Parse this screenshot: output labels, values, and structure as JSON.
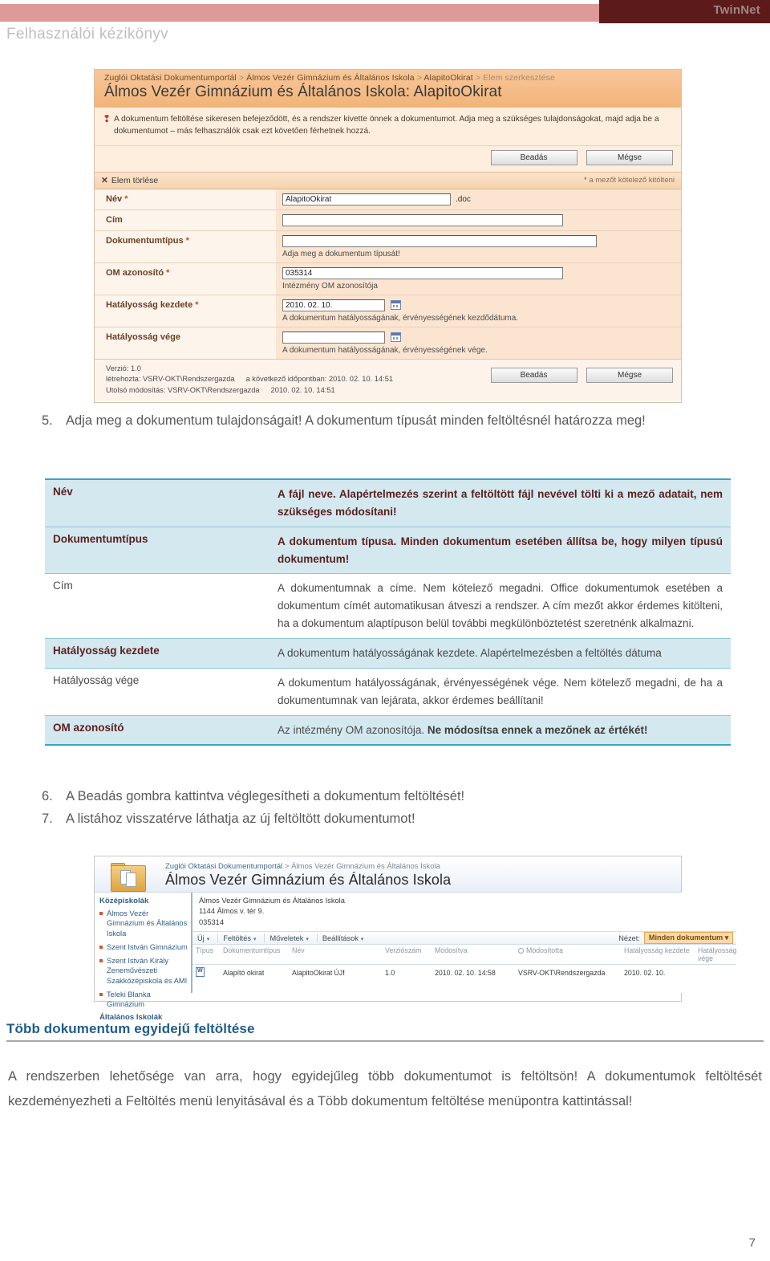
{
  "page_header": {
    "subtitle": "Felhasználói kézikönyv",
    "logo": "TwinNet",
    "band_color": "#de9a98",
    "logo_bg": "#5d1a1a"
  },
  "form_screenshot": {
    "breadcrumb": {
      "part1": "Zuglói Oktatási Dokumentumportál",
      "part2": "Álmos Vezér Gimnázium és Általános Iskola",
      "part3": "AlapitoOkirat",
      "part4": "Elem szerkesztése",
      "separator": ">"
    },
    "title": "Álmos Vezér Gimnázium és Általános Iskola: AlapitoOkirat",
    "notice_line1": "A dokumentum feltöltése sikeresen befejeződött, és a rendszer kivette önnek a dokumentumot. Adja meg a szükséges tulajdonságokat, majd adja be a",
    "notice_line2": "dokumentumot – más felhasználók csak ezt követően férhetnek hozzá.",
    "notice_link": "tulajdonságokat",
    "submit_label": "Beadás",
    "cancel_label": "Mégse",
    "delete_label": "Elem törlése",
    "required_note": "a mezőt kötelező kitölteni",
    "required_star": "*",
    "fields": [
      {
        "label": "Név",
        "required": true,
        "value": "AlapitoOkirat",
        "suffix": ".doc",
        "hint": ""
      },
      {
        "label": "Cím",
        "required": false,
        "value": "",
        "suffix": "",
        "hint": ""
      },
      {
        "label": "Dokumentumtípus",
        "required": true,
        "value": "",
        "suffix": "",
        "hint": "Adja meg a dokumentum típusát!"
      },
      {
        "label": "OM azonosító",
        "required": true,
        "value": "035314",
        "suffix": "",
        "hint": "Intézmény OM azonosítója"
      },
      {
        "label": "Hatályosság kezdete",
        "required": true,
        "value": "2010. 02. 10.",
        "suffix": "",
        "hint": "A dokumentum hatályosságának, érvényességének kezdődátuma."
      },
      {
        "label": "Hatályosság vége",
        "required": false,
        "value": "",
        "suffix": "",
        "hint": "A dokumentum hatályosságának, érvényességének vége."
      }
    ],
    "footer": {
      "version": "Verzió: 1.0",
      "created": "létrehozta: VSRV-OKT\\Rendszergazda",
      "created_when_label": "a következő időpontban:",
      "created_when": "2010. 02. 10. 14:51",
      "modified": "Utolsó módosítás: VSRV-OKT\\Rendszergazda",
      "modified_when": "2010. 02. 10. 14:51"
    }
  },
  "step5": {
    "num": "5.",
    "text": "Adja meg a dokumentum tulajdonságait! A dokumentum típusát minden feltöltésnél határozza meg!"
  },
  "desc_table": {
    "rows": [
      {
        "key": "Név",
        "value": "A fájl neve. Alapértelmezés szerint a feltöltött fájl nevével tölti ki a mező adatait, nem szükséges módosítani!",
        "highlight": true,
        "bold_value": true
      },
      {
        "key": "Dokumentumtípus",
        "value": "A dokumentum típusa. Minden dokumentum esetében állítsa be, hogy milyen típusú dokumentum!",
        "highlight": true,
        "bold_value": true
      },
      {
        "key": "Cím",
        "value": "A dokumentumnak a címe. Nem kötelező megadni. Office dokumentumok esetében a dokumentum címét automatikusan átveszi a rendszer. A cím mezőt akkor érdemes kitölteni, ha a dokumentum alaptípuson belül további megkülönböztetést szeretnénk alkalmazni.",
        "highlight": false,
        "bold_value": false
      },
      {
        "key": "Hatályosság kezdete",
        "value": "A dokumentum hatályosságának kezdete. Alapértelmezésben a feltöltés dátuma",
        "highlight": true,
        "bold_value": false
      },
      {
        "key": "Hatályosság vége",
        "value": "A dokumentum hatályosságának, érvényességének vége. Nem kötelező megadni, de ha a dokumentumnak van lejárata, akkor érdemes beállítani!",
        "highlight": false,
        "bold_value": false
      },
      {
        "key": "OM azonosító",
        "value_plain": "Az intézmény OM azonosítója. ",
        "value_bold": "Ne módosítsa ennek a mezőnek az értékét!",
        "highlight": true,
        "bold_value": false
      }
    ]
  },
  "steps67": [
    {
      "num": "6.",
      "text": "A Beadás gombra kattintva véglegesítheti a dokumentum feltöltését!"
    },
    {
      "num": "7.",
      "text": "A listához visszatérve láthatja az új feltöltött dokumentumot!"
    }
  ],
  "list_screenshot": {
    "breadcrumb_part1": "Zuglói Oktatási Dokumentumportál",
    "breadcrumb_sep": ">",
    "breadcrumb_part2": "Álmos Vezér Gimnázium és Általános Iskola",
    "title": "Álmos Vezér Gimnázium és Általános Iskola",
    "sidebar": {
      "heading": "Középiskolák",
      "items": [
        "Álmos Vezér Gimnázium és Általános Iskola",
        "Szent István Gimnázium",
        "Szent István Király Zeneművészeti Szakközépiskola és AMI",
        "Teleki Blanka Gimnázium"
      ],
      "heading2": "Általános Iskolák"
    },
    "address": {
      "line1": "Álmos Vezér Gimnázium és Általános Iskola",
      "line2": "1144 Álmos v. tér 9.",
      "line3": "035314"
    },
    "toolbar": {
      "items": [
        "Új",
        "Feltöltés",
        "Műveletek",
        "Beállítások"
      ],
      "view_label": "Nézet:",
      "view_selected": "Minden dokumentum"
    },
    "columns": [
      "Típus",
      "Dokumentumtípus",
      "Név",
      "Verziószám",
      "Módosítva",
      "Módosította",
      "Hatályosság kezdete",
      "Hatályosság vége"
    ],
    "rows": [
      {
        "type_icon": "word-document-icon",
        "doctype": "Alapító okirat",
        "name": "AlapitoOkirat",
        "name_badge": "ÚJ",
        "version": "1.0",
        "modified": "2010. 02. 10. 14:58",
        "modified_by": "VSRV-OKT\\Rendszergazda",
        "valid_from": "2010. 02. 10.",
        "valid_to": ""
      }
    ]
  },
  "section": {
    "heading": "Több dokumentum egyidejű feltöltése",
    "paragraph": " A rendszerben lehetősége van arra, hogy egyidejűleg több dokumentumot is feltöltsön! A dokumentumok feltöltését kezdeményezheti a Feltöltés menü lenyitásával és a Több dokumentum feltöltése menüpontra kattintással!"
  },
  "page_number": "7"
}
